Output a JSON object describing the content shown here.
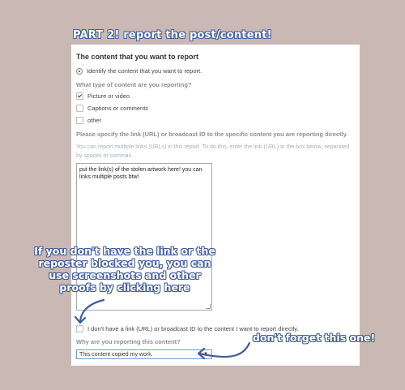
{
  "part_title": "PART 2! report the post/content!",
  "form": {
    "section_heading": "The content that you want to report",
    "identify_option": "Identify the content that you want to report.",
    "content_type_question": "What type of content are you reporting?",
    "content_types": [
      {
        "label": "Picture or video",
        "checked": true
      },
      {
        "label": "Captions or comments",
        "checked": false
      },
      {
        "label": "other",
        "checked": false
      }
    ],
    "link_question": "Please specify the link (URL) or broadcast ID to the specific content you are reporting directly.",
    "link_helper": "You can report multiple links (URLs) in this report. To do this, enter the link (URL) in the box below, separated by spaces or commas.",
    "link_box_value": "put the link(s) of the stolen artwork here! you can links multiple posts btw!",
    "no_link_option": "I don't have a link (URL) or broadcast ID to the content I want to report directly.",
    "reason_question": "Why are you reporting this content?",
    "reason_selected": "This content copied my work."
  },
  "annotations": {
    "no_link_tip": "If you don't have the link or the reposter blocked you, you can use screenshots and other proofs by clicking here",
    "reason_tip": "don't forget this one!"
  },
  "colors": {
    "background": "#c9b8b3",
    "annotation_outline": "#3f5c9c"
  }
}
